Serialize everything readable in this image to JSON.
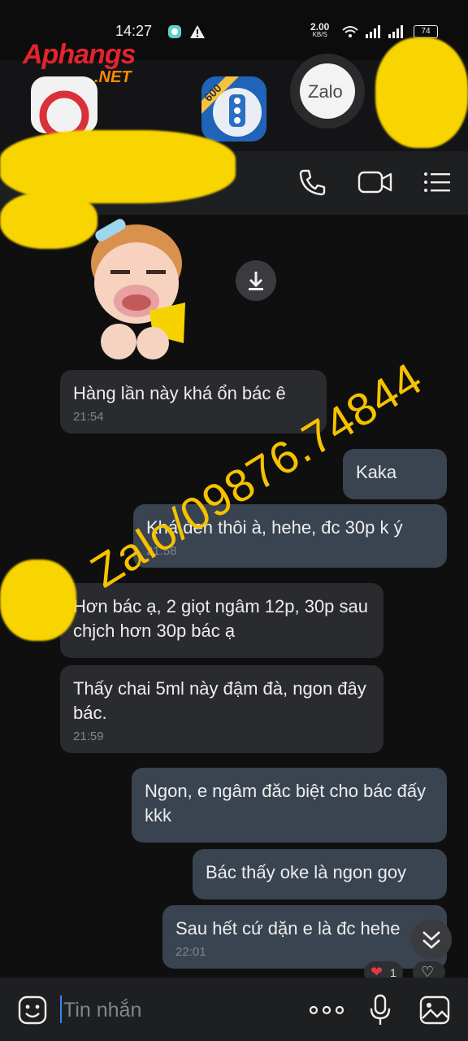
{
  "status_bar": {
    "time": "14:27",
    "net_speed_value": "2.00",
    "net_speed_unit": "KB/S",
    "battery": "74"
  },
  "branding": {
    "logo_main": "Aphangs",
    "logo_suffix": ".NET",
    "watermark": "Zalo/09876.74844"
  },
  "app_icons": {
    "badge_count": "600",
    "zalo_label": "Zalo"
  },
  "messages": [
    {
      "direction": "in",
      "text": "Hàng lần này khá ổn bác ê",
      "time": "21:54"
    },
    {
      "direction": "out",
      "text": "Kaka",
      "time": ""
    },
    {
      "direction": "out",
      "text": "Khá đen thôi à, hehe, đc 30p k ý",
      "time": "21:58"
    },
    {
      "direction": "in",
      "text": "Hơn bác ạ, 2 giọt ngâm 12p, 30p sau chjch hơn 30p bác ạ",
      "time": ""
    },
    {
      "direction": "in",
      "text": "Thấy chai 5ml này đậm đà, ngon đây bác.",
      "time": "21:59"
    },
    {
      "direction": "out",
      "text": "Ngon, e ngâm đăc biệt cho bác đấy kkk",
      "time": ""
    },
    {
      "direction": "out",
      "text": "Bác thấy oke là ngon goy",
      "time": ""
    },
    {
      "direction": "out",
      "text": "Sau hết cứ dặn e là đc hehe",
      "time": "22:01"
    }
  ],
  "reactions": {
    "heart_count": "1"
  },
  "input": {
    "placeholder": "Tin nhắn"
  },
  "colors": {
    "incoming_bubble": "#2a2b2e",
    "outgoing_bubble": "#3a4350",
    "accent": "#3b82f6",
    "watermark": "#f6c200"
  }
}
